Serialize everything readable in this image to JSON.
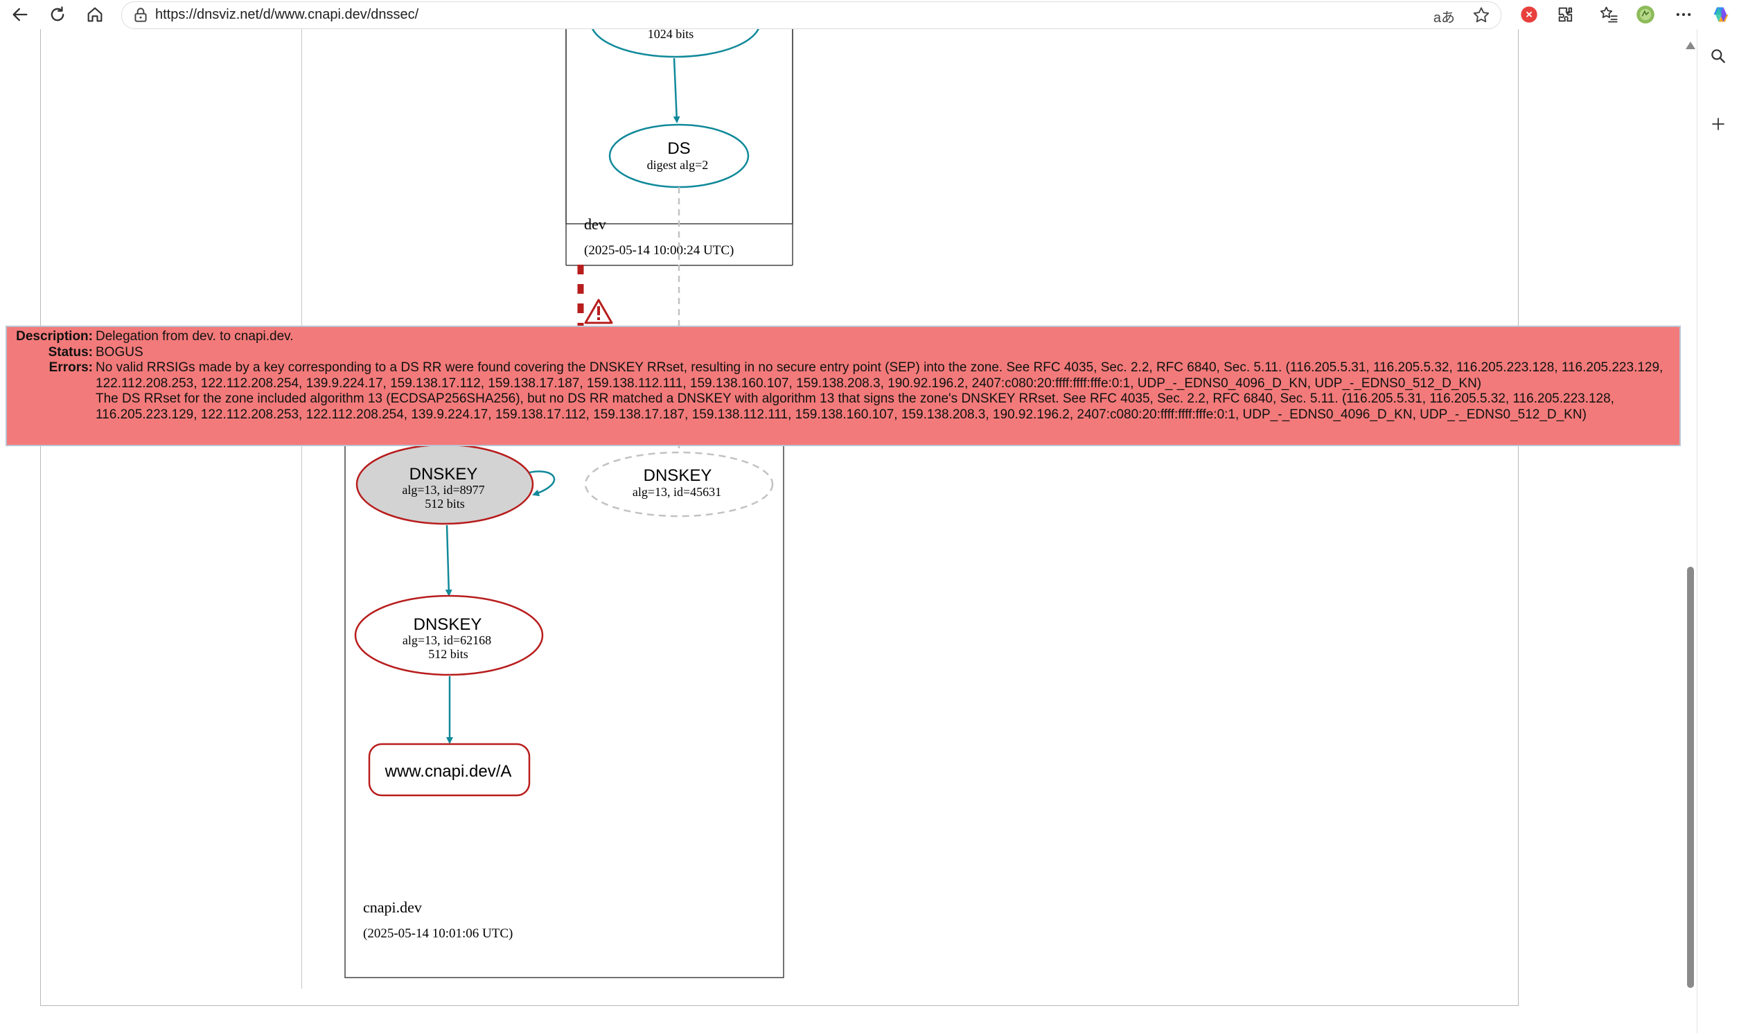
{
  "browser": {
    "url": "https://dnsviz.net/d/www.cnapi.dev/dnssec/",
    "read_aloud_label": "aあ"
  },
  "graph": {
    "parent_zone": {
      "name": "dev",
      "timestamp": "(2025-05-14 10:00:24 UTC)",
      "partial_key_text": "1024 bits",
      "ds_node": {
        "title": "DS",
        "subtitle": "digest alg=2"
      }
    },
    "child_zone": {
      "name": "cnapi.dev",
      "timestamp": "(2025-05-14 10:01:06 UTC)",
      "ksk": {
        "title": "DNSKEY",
        "line1": "alg=13, id=8977",
        "line2": "512 bits"
      },
      "missing_key": {
        "title": "DNSKEY",
        "line1": "alg=13, id=45631"
      },
      "zsk": {
        "title": "DNSKEY",
        "line1": "alg=13, id=62168",
        "line2": "512 bits"
      },
      "rrset": {
        "label": "www.cnapi.dev/A"
      }
    },
    "colors": {
      "secure_edge": "#10899a",
      "bogus": "#b81d1d",
      "insecure_dashed": "#c2c2c2",
      "tooltip_bg": "#f37a7a"
    }
  },
  "tooltip": {
    "description_label": "Description:",
    "description": "Delegation from dev. to cnapi.dev.",
    "status_label": "Status:",
    "status": "BOGUS",
    "errors_label": "Errors:",
    "error_1": "No valid RRSIGs made by a key corresponding to a DS RR were found covering the DNSKEY RRset, resulting in no secure entry point (SEP) into the zone. See RFC 4035, Sec. 2.2, RFC 6840, Sec. 5.11. (116.205.5.31, 116.205.5.32, 116.205.223.128, 116.205.223.129, 122.112.208.253, 122.112.208.254, 139.9.224.17, 159.138.17.112, 159.138.17.187, 159.138.112.111, 159.138.160.107, 159.138.208.3, 190.92.196.2, 2407:c080:20:ffff:ffff:fffe:0:1, UDP_-_EDNS0_4096_D_KN, UDP_-_EDNS0_512_D_KN)",
    "error_2": "The DS RRset for the zone included algorithm 13 (ECDSAP256SHA256), but no DS RR matched a DNSKEY with algorithm 13 that signs the zone's DNSKEY RRset. See RFC 4035, Sec. 2.2, RFC 6840, Sec. 5.11. (116.205.5.31, 116.205.5.32, 116.205.223.128, 116.205.223.129, 122.112.208.253, 122.112.208.254, 139.9.224.17, 159.138.17.112, 159.138.17.187, 159.138.112.111, 159.138.160.107, 159.138.208.3, 190.92.196.2, 2407:c080:20:ffff:ffff:fffe:0:1, UDP_-_EDNS0_4096_D_KN, UDP_-_EDNS0_512_D_KN)"
  },
  "icons": {
    "back": "arrow-left-icon",
    "reload": "reload-icon",
    "home": "home-icon",
    "site_info": "lock-icon",
    "favorite": "star-icon",
    "extensions": "puzzle-icon",
    "favorites_bar": "favorites-icon",
    "profile": "avatar",
    "more": "more-icon",
    "copilot": "copilot-icon",
    "search": "search-icon",
    "add": "plus-icon",
    "warning": "warning-icon"
  }
}
